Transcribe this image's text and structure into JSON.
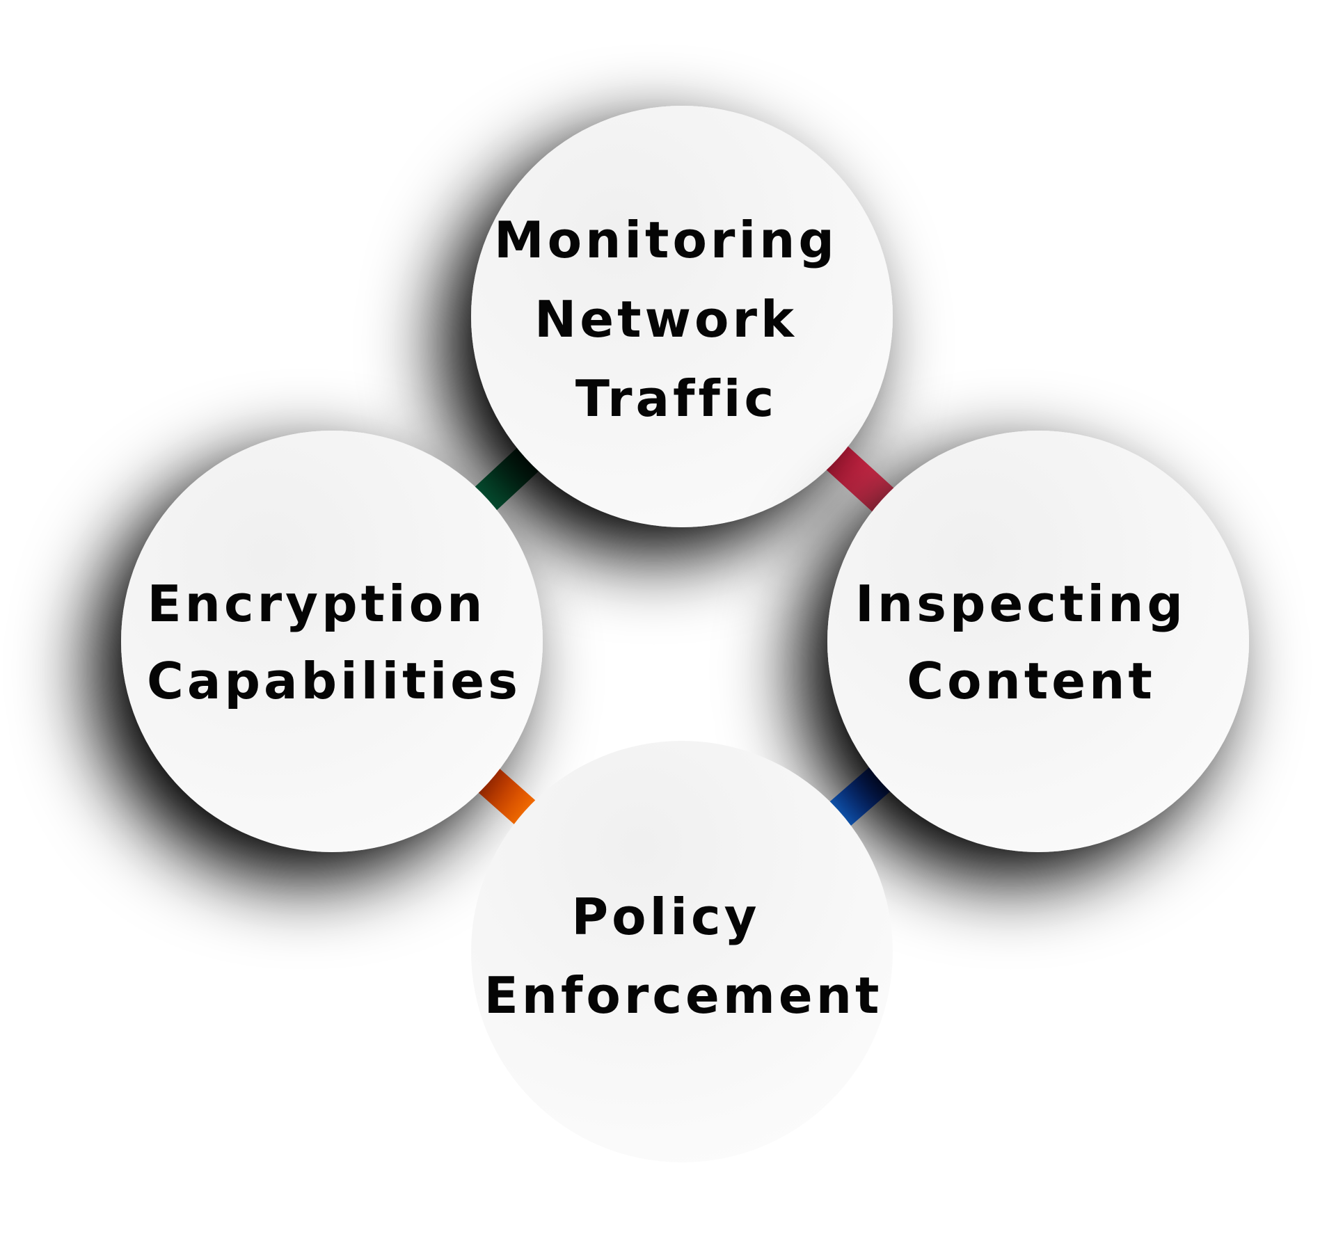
{
  "nodes": [
    {
      "id": "monitoring",
      "lines": [
        "Monitoring",
        "Network",
        "Traffic"
      ]
    },
    {
      "id": "inspecting",
      "lines": [
        "Inspecting",
        "Content"
      ]
    },
    {
      "id": "policy",
      "lines": [
        "Policy",
        "Enforcement"
      ]
    },
    {
      "id": "encryption",
      "lines": [
        "Encryption",
        "Capabilities"
      ]
    }
  ],
  "connectors": [
    {
      "from": "monitoring",
      "to": "inspecting",
      "colors": [
        "#ff1744",
        "#ff4d6d"
      ]
    },
    {
      "from": "inspecting",
      "to": "policy",
      "colors": [
        "#0022ff",
        "#1e9bff"
      ]
    },
    {
      "from": "policy",
      "to": "encryption",
      "colors": [
        "#ff8a00",
        "#ff2a00"
      ]
    },
    {
      "from": "encryption",
      "to": "monitoring",
      "colors": [
        "#0a8a5a",
        "#003d1a"
      ]
    }
  ],
  "colors": {
    "circle_fill": "#f2f2f2",
    "circle_fill_light": "#fbfbfb",
    "text": "#050505",
    "background": "#ffffff"
  }
}
